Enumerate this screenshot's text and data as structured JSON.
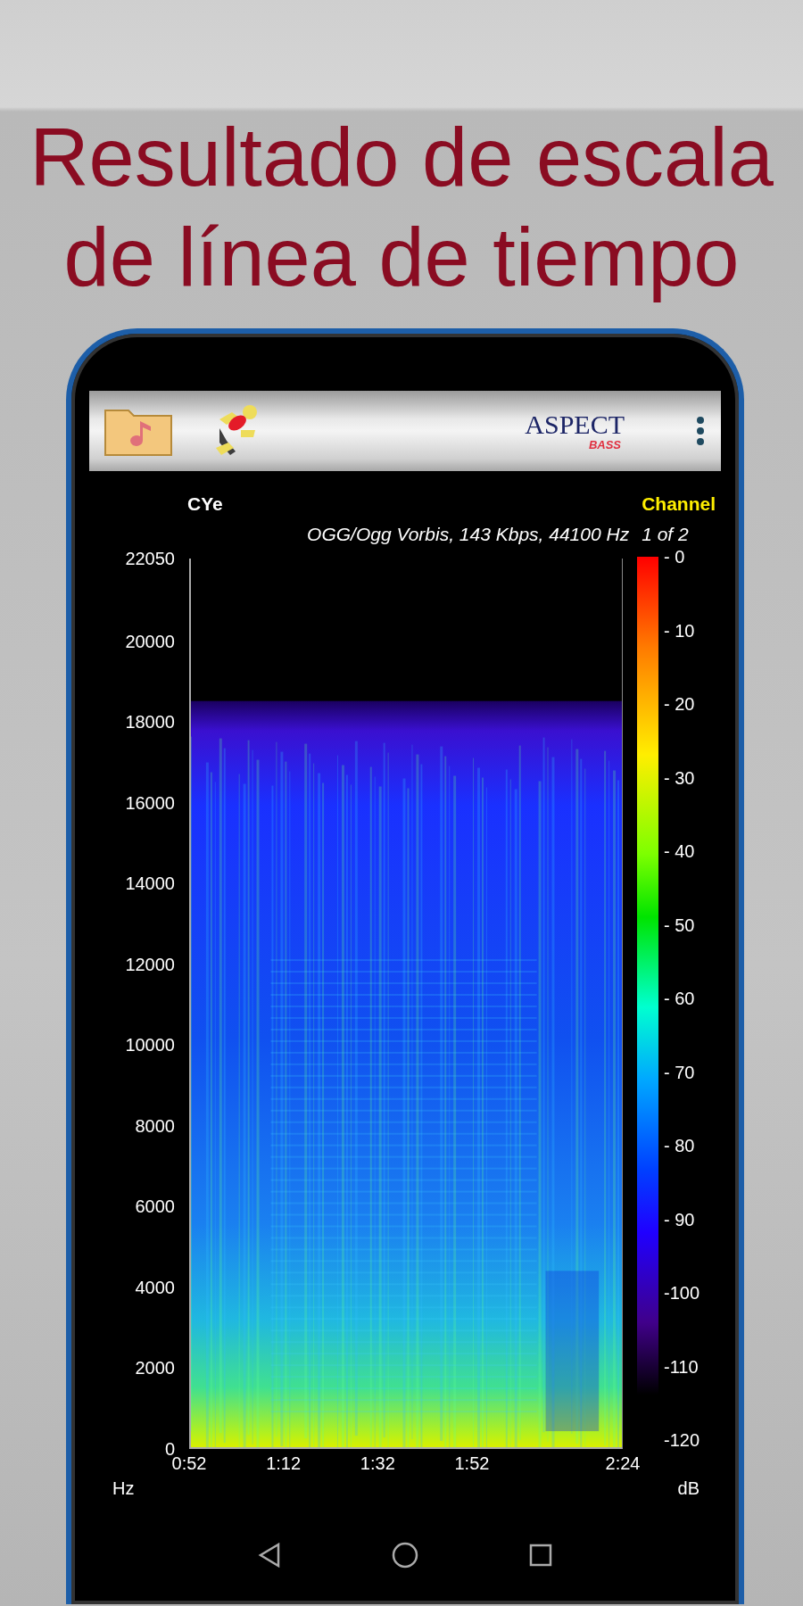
{
  "headline": [
    "Resultado de escala",
    "de línea de tiempo"
  ],
  "toolbar": {
    "logo": {
      "name": "ASPECT",
      "sub": "BASS"
    }
  },
  "track": {
    "title": "CYe",
    "format": "OGG/Ogg Vorbis, 143 Kbps, 44100 Hz",
    "channel_label": "Channel",
    "channel": "1 of 2"
  },
  "spectrogram": {
    "y_unit": "Hz",
    "y_ticks": [
      "22050",
      "20000",
      "18000",
      "16000",
      "14000",
      "12000",
      "10000",
      "8000",
      "6000",
      "4000",
      "2000",
      "0"
    ],
    "x_ticks": [
      "0:52",
      "1:12",
      "1:32",
      "1:52",
      "2:24"
    ],
    "scale_unit": "dB",
    "scale_ticks": [
      "- 0",
      "- 10",
      "- 20",
      "- 30",
      "- 40",
      "- 50",
      "- 60",
      "- 70",
      "- 80",
      "- 90",
      "-100",
      "-110",
      "-120"
    ]
  }
}
